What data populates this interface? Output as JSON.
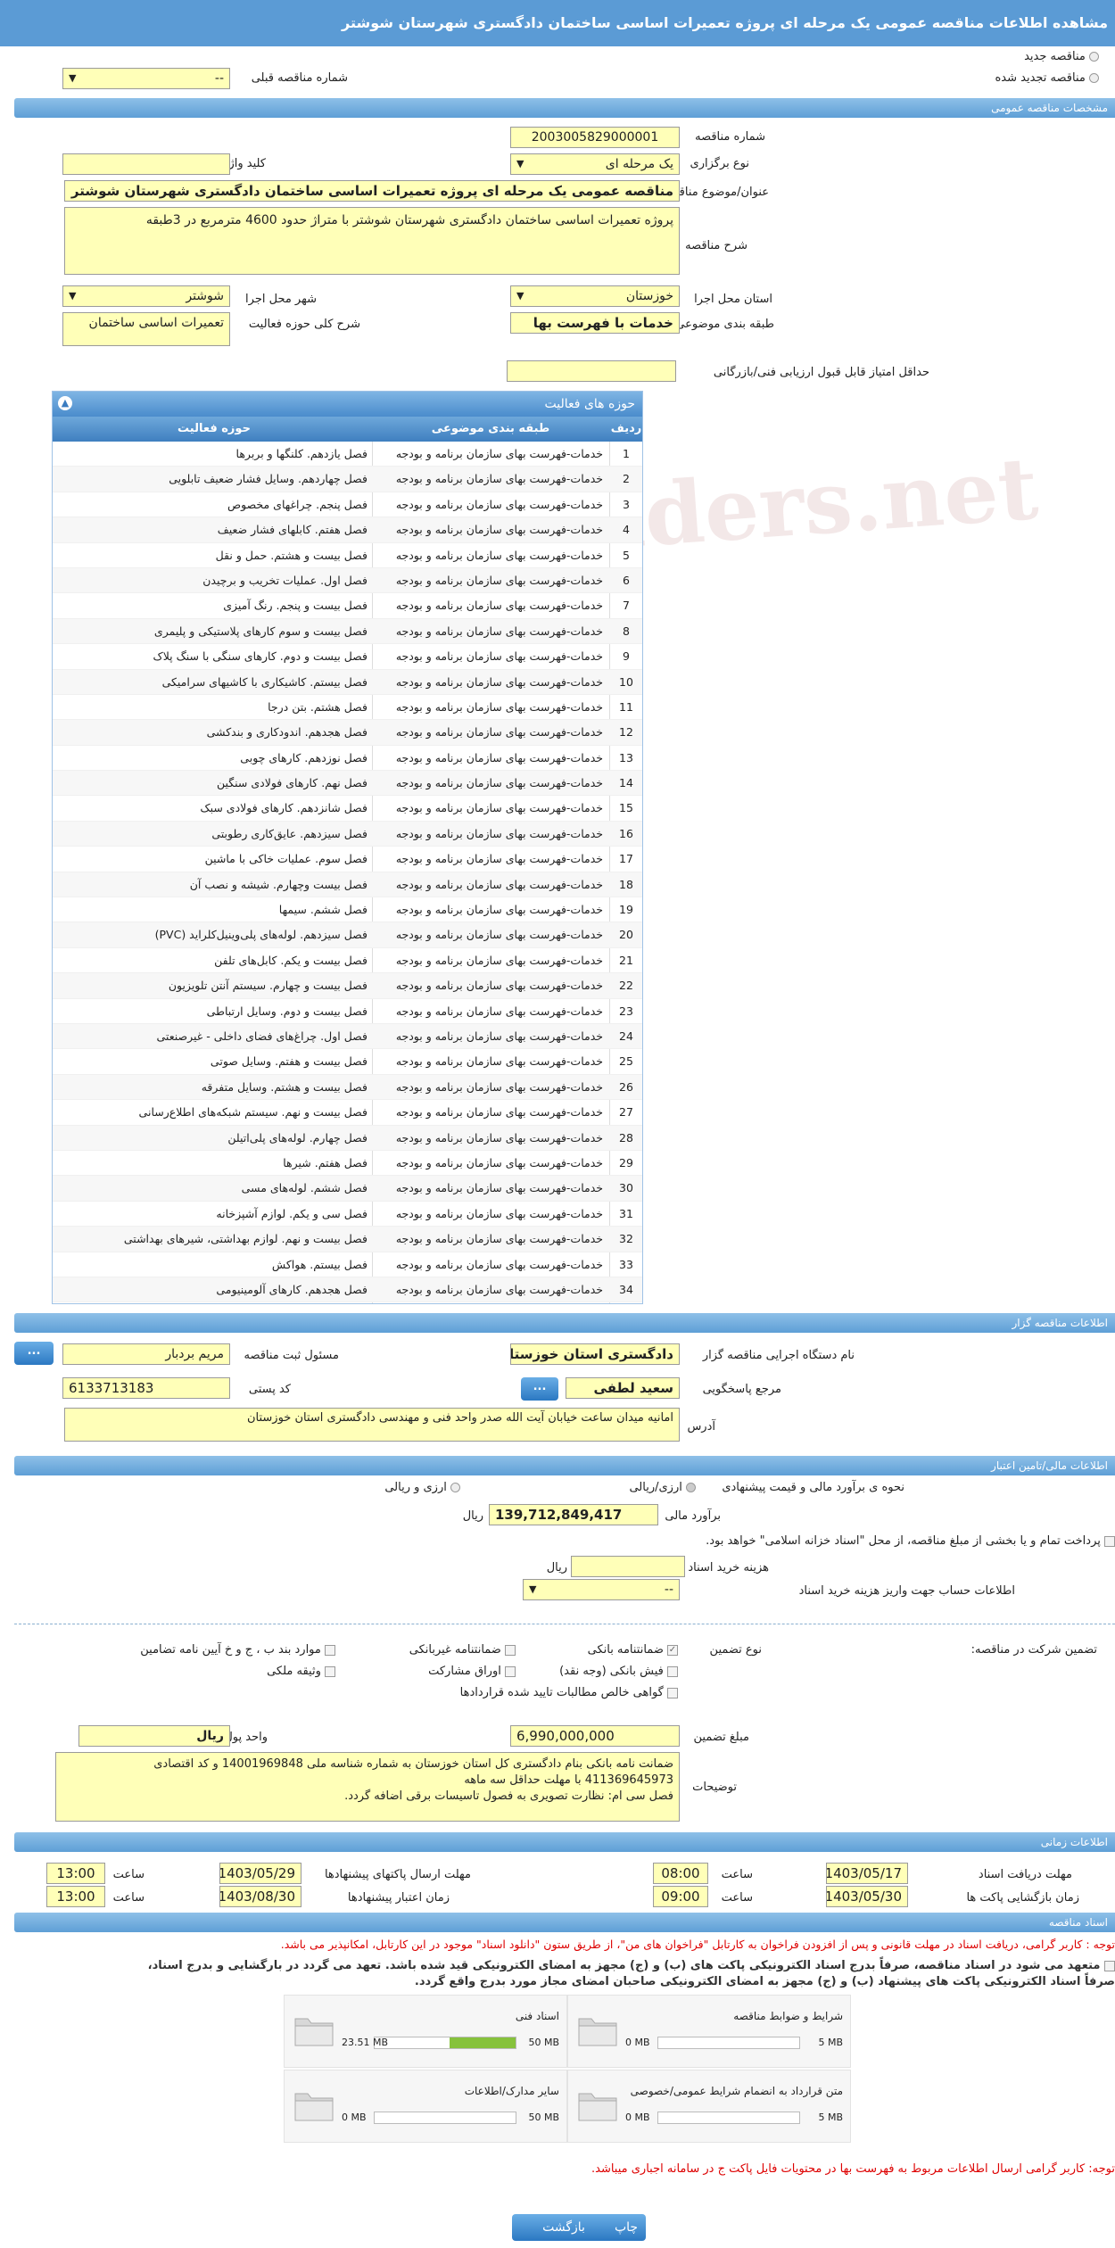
{
  "title": "مشاهده اطلاعات مناقصه عمومی یک مرحله ای پروژه تعمیرات اساسی ساختمان دادگستری شهرستان شوشتر",
  "top": {
    "new_tender": "مناقصه جدید",
    "renew_tender": "مناقصه تجدید شده",
    "prev_number_label": "شماره مناقصه قبلی",
    "prev_number_value": "--"
  },
  "sections": {
    "general": "مشخصات مناقصه عمومی",
    "organizer": "اطلاعات مناقصه گزار",
    "financial": "اطلاعات مالی/تامین اعتبار",
    "timing": "اطلاعات زمانی",
    "documents": "اسناد مناقصه"
  },
  "general": {
    "number_label": "شماره مناقصه",
    "number_value": "2003005829000001",
    "type_label": "نوع برگزاری",
    "type_value": "یک مرحله ای",
    "keyword_label": "کلید واژه",
    "keyword_value": "",
    "subject_label": "عنوان/موضوع مناقصه",
    "subject_value": "مناقصه عمومی یک مرحله ای پروژه تعمیرات اساسی ساختمان دادگستری شهرستان شوشتر",
    "desc_label": "شرح مناقصه",
    "desc_value": "پروژه تعمیرات اساسی ساختمان دادگستری شهرستان شوشتر با متراژ حدود 4600 مترمربع در 3طبقه",
    "province_label": "استان محل اجرا",
    "province_value": "خوزستان",
    "city_label": "شهر محل اجرا",
    "city_value": "شوشتر",
    "category_label": "طبقه بندی موضوعی",
    "category_value": "خدمات با فهرست بها",
    "activity_label": "شرح کلی حوزه فعالیت",
    "activity_value": "تعمیرات اساسی ساختمان",
    "min_score_label": "حداقل امتیاز قابل قبول ارزیابی فنی/بازرگانی",
    "min_score_value": ""
  },
  "activity_grid": {
    "title": "حوزه های فعالیت",
    "headers": [
      "ردیف",
      "طبقه بندی موضوعی",
      "حوزه فعالیت"
    ],
    "rows": [
      [
        "1",
        "خدمات-فهرست بهای سازمان برنامه و بودجه",
        "فصل یازدهم. کلنگها و بربرها"
      ],
      [
        "2",
        "خدمات-فهرست بهای سازمان برنامه و بودجه",
        "فصل چهاردهم. وسایل فشار ضعیف تابلویی"
      ],
      [
        "3",
        "خدمات-فهرست بهای سازمان برنامه و بودجه",
        "فصل پنجم. چراغهای مخصوص"
      ],
      [
        "4",
        "خدمات-فهرست بهای سازمان برنامه و بودجه",
        "فصل هفتم. کابلهای فشار ضعیف"
      ],
      [
        "5",
        "خدمات-فهرست بهای سازمان برنامه و بودجه",
        "فصل بیست و هشتم. حمل و نقل"
      ],
      [
        "6",
        "خدمات-فهرست بهای سازمان برنامه و بودجه",
        "فصل اول. عملیات تخریب و برچیدن"
      ],
      [
        "7",
        "خدمات-فهرست بهای سازمان برنامه و بودجه",
        "فصل بیست و پنجم. رنگ آمیزی"
      ],
      [
        "8",
        "خدمات-فهرست بهای سازمان برنامه و بودجه",
        "فصل بیست و سوم کارهای پلاستیکی و پلیمری"
      ],
      [
        "9",
        "خدمات-فهرست بهای سازمان برنامه و بودجه",
        "فصل بیست و دوم. کارهای سنگی با سنگ پلاک"
      ],
      [
        "10",
        "خدمات-فهرست بهای سازمان برنامه و بودجه",
        "فصل بیستم. کاشیکاری با کاشیهای سرامیکی"
      ],
      [
        "11",
        "خدمات-فهرست بهای سازمان برنامه و بودجه",
        "فصل هشتم. بتن درجا"
      ],
      [
        "12",
        "خدمات-فهرست بهای سازمان برنامه و بودجه",
        "فصل هجدهم. اندودکاری و بندکشی"
      ],
      [
        "13",
        "خدمات-فهرست بهای سازمان برنامه و بودجه",
        "فصل نوزدهم. کارهای چوبی"
      ],
      [
        "14",
        "خدمات-فهرست بهای سازمان برنامه و بودجه",
        "فصل نهم. کارهای فولادی سنگین"
      ],
      [
        "15",
        "خدمات-فهرست بهای سازمان برنامه و بودجه",
        "فصل شانزدهم. کارهای فولادی سبک"
      ],
      [
        "16",
        "خدمات-فهرست بهای سازمان برنامه و بودجه",
        "فصل سیزدهم. عایق‌کاری رطوبتی"
      ],
      [
        "17",
        "خدمات-فهرست بهای سازمان برنامه و بودجه",
        "فصل سوم. عملیات خاکی با ماشین"
      ],
      [
        "18",
        "خدمات-فهرست بهای سازمان برنامه و بودجه",
        "فصل بیست وچهارم. شیشه و نصب آن"
      ],
      [
        "19",
        "خدمات-فهرست بهای سازمان برنامه و بودجه",
        "فصل ششم. سیمها"
      ],
      [
        "20",
        "خدمات-فهرست بهای سازمان برنامه و بودجه",
        "فصل سیزدهم. لوله‌های پلی‌وینیل‌کلراید (PVC)"
      ],
      [
        "21",
        "خدمات-فهرست بهای سازمان برنامه و بودجه",
        "فصل بیست و یکم. کابل‌های تلفن"
      ],
      [
        "22",
        "خدمات-فهرست بهای سازمان برنامه و بودجه",
        "فصل بیست و چهارم. سیستم آنتن تلویزیون"
      ],
      [
        "23",
        "خدمات-فهرست بهای سازمان برنامه و بودجه",
        "فصل بیست و دوم. وسایل ارتباطی"
      ],
      [
        "24",
        "خدمات-فهرست بهای سازمان برنامه و بودجه",
        "فصل اول. چراغ‌های فضای داخلی - غیرصنعتی"
      ],
      [
        "25",
        "خدمات-فهرست بهای سازمان برنامه و بودجه",
        "فصل بیست و هفتم. وسایل صوتی"
      ],
      [
        "26",
        "خدمات-فهرست بهای سازمان برنامه و بودجه",
        "فصل بیست و هشتم. وسایل متفرقه"
      ],
      [
        "27",
        "خدمات-فهرست بهای سازمان برنامه و بودجه",
        "فصل بیست و نهم. سیستم شبکه‌های اطلاع‌رسانی"
      ],
      [
        "28",
        "خدمات-فهرست بهای سازمان برنامه و بودجه",
        "فصل چهارم. لوله‌های پلی‌اتیلن"
      ],
      [
        "29",
        "خدمات-فهرست بهای سازمان برنامه و بودجه",
        "فصل هفتم. شیرها"
      ],
      [
        "30",
        "خدمات-فهرست بهای سازمان برنامه و بودجه",
        "فصل ششم. لوله‌های مسی"
      ],
      [
        "31",
        "خدمات-فهرست بهای سازمان برنامه و بودجه",
        "فصل سی و یکم. لوازم آشپزخانه"
      ],
      [
        "32",
        "خدمات-فهرست بهای سازمان برنامه و بودجه",
        "فصل بیست و نهم. لوازم بهداشتی، شیرهای بهداشتی"
      ],
      [
        "33",
        "خدمات-فهرست بهای سازمان برنامه و بودجه",
        "فصل بیستم. هواکش"
      ],
      [
        "34",
        "خدمات-فهرست بهای سازمان برنامه و بودجه",
        "فصل هجدهم. کارهای آلومینیومی"
      ]
    ]
  },
  "organizer": {
    "executor_label": "نام دستگاه اجرایی مناقصه گزار",
    "executor_value": "دادگستری استان خوزستان",
    "registrar_label": "مسئول ثبت مناقصه",
    "registrar_value": "مریم بردبار",
    "responder_label": "مرجع پاسخگویی",
    "responder_value": "سعید لطفی",
    "postal_label": "کد پستی",
    "postal_value": "6133713183",
    "address_label": "آدرس",
    "address_value": "امانیه میدان ساعت خیابان آیت الله صدر واحد فنی و مهندسی دادگستری استان خوزستان",
    "more_button": "..."
  },
  "financial": {
    "estimate_label": "نحوه ی برآورد مالی و قیمت پیشنهادی",
    "opt_rial": "ارزی/ریالی",
    "opt_both": "ارزی و ریالی",
    "budget_label": "برآورد مالی",
    "budget_value": "139,712,849,417",
    "currency": "ریال",
    "treasury_text": "پرداخت تمام و یا بخشی از مبلغ مناقصه، از محل \"اسناد خزانه اسلامی\" خواهد بود.",
    "doc_cost_label": "هزینه خرید اسناد",
    "doc_cost_value": "",
    "doc_cost_unit": "ریال",
    "account_label": "اطلاعات حساب جهت واریز هزینه خرید اسناد",
    "account_value": "--"
  },
  "guarantee": {
    "label": "تضمین شرکت در مناقصه:",
    "type_label": "نوع تضمین",
    "options": [
      "ضمانتنامه بانکی",
      "ضمانتنامه غیربانکی",
      "موارد بند ب ، ج و خ آیین نامه تضامین",
      "فیش بانکی (وجه نقد)",
      "اوراق مشارکت",
      "وثیقه ملکی",
      "گواهی خالص مطالبات تایید شده قراردادها"
    ],
    "amount_label": "مبلغ تضمین",
    "amount_value": "6,990,000,000",
    "unit_label": "واحد پول",
    "unit_value": "ریال",
    "notes_label": "توضیحات",
    "notes_line1": "ضمانت نامه بانکی بنام دادگستری کل استان خوزستان به شماره شناسه ملی 14001969848 و کد اقتصادی",
    "notes_line2": "411369645973 با مهلت حداقل سه ماهه",
    "notes_line3": "فصل سی ام: نظارت تصویری به فصول تاسیسات برقی اضافه گردد."
  },
  "timing": {
    "receive_label": "مهلت دریافت اسناد",
    "receive_date": "1403/05/17",
    "receive_time": "08:00",
    "send_label": "مهلت ارسال پاکتهای پیشنهادها",
    "send_date": "1403/05/29",
    "send_time": "13:00",
    "open_label": "زمان بازگشایی پاکت ها",
    "open_date": "1403/05/30",
    "open_time": "09:00",
    "valid_label": "زمان اعتبار پیشنهادها",
    "valid_date": "1403/08/30",
    "valid_time": "13:00",
    "time_label": "ساعت"
  },
  "documents": {
    "note1": "توجه : کاربر گرامی، دریافت اسناد در مهلت قانونی و پس از افزودن فراخوان به کارتابل \"فراخوان های من\"، از طریق ستون \"دانلود اسناد\" موجود در این کارتابل، امکانپذیر می باشد.",
    "commit1": "متعهد می شود در اسناد مناقصه، صرفاً بدرج اسناد الکترونیکی پاکت های (ب) و (ج) مجهز به امضای الکترونیکی قید شده باشد. تعهد می گردد در بارگشایی و بدرج اسناد،",
    "commit2": "صرفاً اسناد الکترونیکی پاکت های پیشنهاد (ب) و (ج) مجهز به امضای الکترونیکی صاحبان امضای مجاز مورد بدرج واقع گردد.",
    "files": [
      {
        "name": "شرایط و ضوابط مناقصه",
        "used": "0 MB",
        "max": "5 MB",
        "fill": 0
      },
      {
        "name": "اسناد فنی",
        "used": "23.51 MB",
        "max": "50 MB",
        "fill": 0.47
      },
      {
        "name": "متن قرارداد به انضمام شرایط عمومی/خصوصی",
        "used": "0 MB",
        "max": "5 MB",
        "fill": 0
      },
      {
        "name": "سایر مدارک/اطلاعات",
        "used": "0 MB",
        "max": "50 MB",
        "fill": 0
      }
    ],
    "note2": "توجه: کاربر گرامی ارسال اطلاعات مربوط به فهرست بها در محتویات فایل پاکت ج در سامانه اجباری میباشد."
  },
  "buttons": {
    "back": "بازگشت",
    "print": "چاپ"
  },
  "watermark": "ariaTenders.net"
}
